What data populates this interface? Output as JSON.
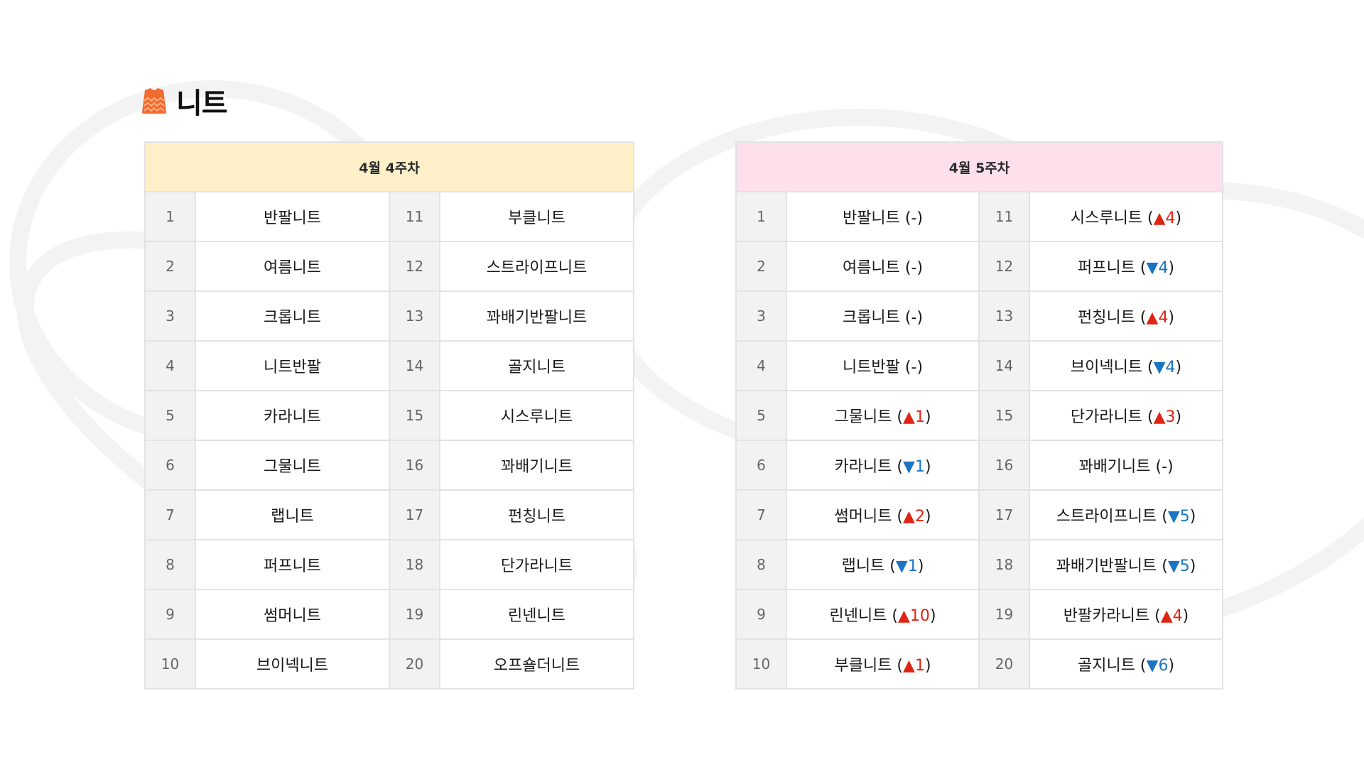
{
  "title": "니트",
  "colors": {
    "header_week4": "#fdf0c9",
    "header_week5": "#fde0ec",
    "up": "#e02414",
    "down": "#1b74c2",
    "icon": "#f26a2e"
  },
  "icon": "knit-sweater-icon",
  "week4": {
    "header": "4월 4주차",
    "rows": [
      {
        "rank_a": "1",
        "item_a": "반팔니트",
        "rank_b": "11",
        "item_b": "부클니트"
      },
      {
        "rank_a": "2",
        "item_a": "여름니트",
        "rank_b": "12",
        "item_b": "스트라이프니트"
      },
      {
        "rank_a": "3",
        "item_a": "크롭니트",
        "rank_b": "13",
        "item_b": "꽈배기반팔니트"
      },
      {
        "rank_a": "4",
        "item_a": "니트반팔",
        "rank_b": "14",
        "item_b": "골지니트"
      },
      {
        "rank_a": "5",
        "item_a": "카라니트",
        "rank_b": "15",
        "item_b": "시스루니트"
      },
      {
        "rank_a": "6",
        "item_a": "그물니트",
        "rank_b": "16",
        "item_b": "꽈배기니트"
      },
      {
        "rank_a": "7",
        "item_a": "랩니트",
        "rank_b": "17",
        "item_b": "펀칭니트"
      },
      {
        "rank_a": "8",
        "item_a": "퍼프니트",
        "rank_b": "18",
        "item_b": "단가라니트"
      },
      {
        "rank_a": "9",
        "item_a": "썸머니트",
        "rank_b": "19",
        "item_b": "린넨니트"
      },
      {
        "rank_a": "10",
        "item_a": "브이넥니트",
        "rank_b": "20",
        "item_b": "오프숄더니트"
      }
    ]
  },
  "week5": {
    "header": "4월 5주차",
    "rows": [
      {
        "rank_a": "1",
        "item_a": "반팔니트",
        "dir_a": "same",
        "chg_a": "-",
        "rank_b": "11",
        "item_b": "시스루니트",
        "dir_b": "up",
        "chg_b": "4"
      },
      {
        "rank_a": "2",
        "item_a": "여름니트",
        "dir_a": "same",
        "chg_a": "-",
        "rank_b": "12",
        "item_b": "퍼프니트",
        "dir_b": "down",
        "chg_b": "4"
      },
      {
        "rank_a": "3",
        "item_a": "크롭니트",
        "dir_a": "same",
        "chg_a": "-",
        "rank_b": "13",
        "item_b": "펀칭니트",
        "dir_b": "up",
        "chg_b": "4"
      },
      {
        "rank_a": "4",
        "item_a": "니트반팔",
        "dir_a": "same",
        "chg_a": "-",
        "rank_b": "14",
        "item_b": "브이넥니트",
        "dir_b": "down",
        "chg_b": "4"
      },
      {
        "rank_a": "5",
        "item_a": "그물니트",
        "dir_a": "up",
        "chg_a": "1",
        "rank_b": "15",
        "item_b": "단가라니트",
        "dir_b": "up",
        "chg_b": "3"
      },
      {
        "rank_a": "6",
        "item_a": "카라니트",
        "dir_a": "down",
        "chg_a": "1",
        "rank_b": "16",
        "item_b": "꽈배기니트",
        "dir_b": "same",
        "chg_b": "-"
      },
      {
        "rank_a": "7",
        "item_a": "썸머니트",
        "dir_a": "up",
        "chg_a": "2",
        "rank_b": "17",
        "item_b": "스트라이프니트",
        "dir_b": "down",
        "chg_b": "5"
      },
      {
        "rank_a": "8",
        "item_a": "랩니트",
        "dir_a": "down",
        "chg_a": "1",
        "rank_b": "18",
        "item_b": "꽈배기반팔니트",
        "dir_b": "down",
        "chg_b": "5"
      },
      {
        "rank_a": "9",
        "item_a": "린넨니트",
        "dir_a": "up",
        "chg_a": "10",
        "rank_b": "19",
        "item_b": "반팔카라니트",
        "dir_b": "up",
        "chg_b": "4"
      },
      {
        "rank_a": "10",
        "item_a": "부클니트",
        "dir_a": "up",
        "chg_a": "1",
        "rank_b": "20",
        "item_b": "골지니트",
        "dir_b": "down",
        "chg_b": "6"
      }
    ]
  }
}
